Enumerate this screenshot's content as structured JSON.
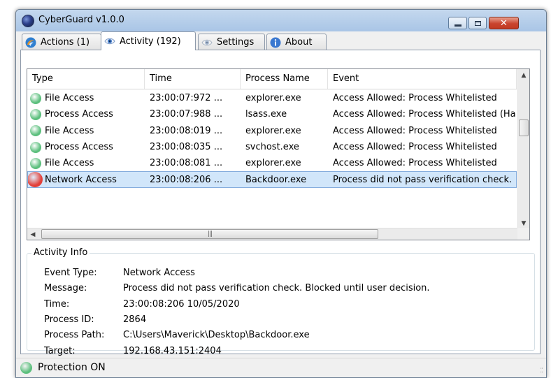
{
  "window": {
    "title": "CyberGuard v1.0.0"
  },
  "tabs": [
    {
      "label": "Actions (1)",
      "icon": "swirl-icon"
    },
    {
      "label": "Activity (192)",
      "icon": "eye-icon",
      "active": true
    },
    {
      "label": "Settings",
      "icon": "eye-icon"
    },
    {
      "label": "About",
      "icon": "info-icon"
    }
  ],
  "activity_list": {
    "columns": [
      "Type",
      "Time",
      "Process Name",
      "Event"
    ],
    "rows": [
      {
        "type": "File Access",
        "time": "23:00:07:972 ...",
        "process": "explorer.exe",
        "event": "Access Allowed: Process Whitelisted",
        "status_color": "#5cbf7d"
      },
      {
        "type": "Process Access",
        "time": "23:00:07:988 ...",
        "process": "lsass.exe",
        "event": "Access Allowed: Process Whitelisted (Ha",
        "status_color": "#5cbf7d"
      },
      {
        "type": "File Access",
        "time": "23:00:08:019 ...",
        "process": "explorer.exe",
        "event": "Access Allowed: Process Whitelisted",
        "status_color": "#5cbf7d"
      },
      {
        "type": "Process Access",
        "time": "23:00:08:035 ...",
        "process": "svchost.exe",
        "event": "Access Allowed: Process Whitelisted",
        "status_color": "#5cbf7d"
      },
      {
        "type": "File Access",
        "time": "23:00:08:081 ...",
        "process": "explorer.exe",
        "event": "Access Allowed: Process Whitelisted",
        "status_color": "#5cbf7d"
      },
      {
        "type": "Network Access",
        "time": "23:00:08:206 ...",
        "process": "Backdoor.exe",
        "event": "Process did not pass verification check.",
        "status_color": "#e2403a",
        "selected": true
      }
    ]
  },
  "activity_info": {
    "title": "Activity Info",
    "fields": [
      {
        "label": "Event Type:",
        "value": "Network Access"
      },
      {
        "label": "Message:",
        "value": "Process did not pass verification check. Blocked until user decision."
      },
      {
        "label": "Time:",
        "value": "23:00:08:206 10/05/2020"
      },
      {
        "label": "Process ID:",
        "value": "2864"
      },
      {
        "label": "Process Path:",
        "value": "C:\\Users\\Maverick\\Desktop\\Backdoor.exe"
      },
      {
        "label": "Target:",
        "value": "192.168.43.151:2404"
      }
    ]
  },
  "status_bar": {
    "text": "Protection ON",
    "color": "#5cbf7d"
  },
  "colors": {
    "allowed": "#5cbf7d",
    "blocked": "#e2403a",
    "selection": "#d1e6fa"
  }
}
